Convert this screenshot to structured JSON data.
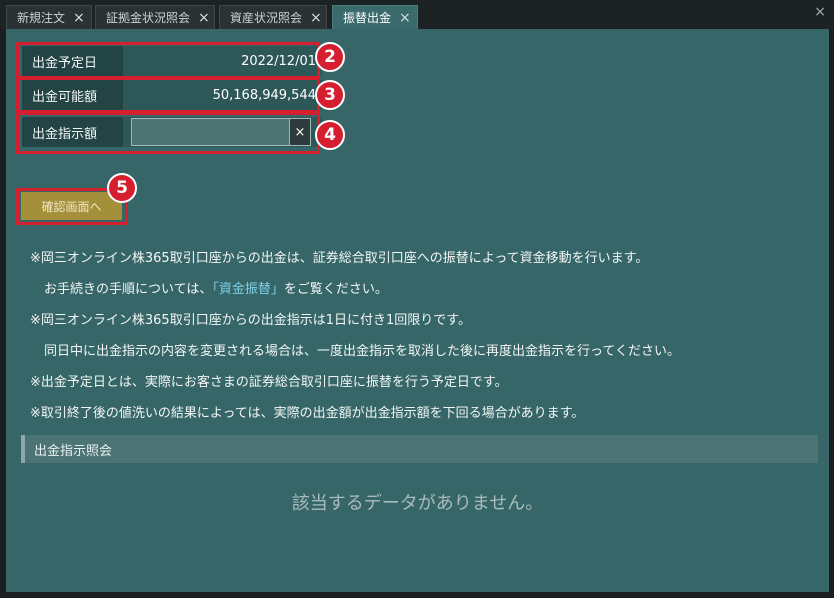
{
  "tabs": [
    {
      "label": "新規注文",
      "active": false
    },
    {
      "label": "証拠金状況照会",
      "active": false
    },
    {
      "label": "資産状況照会",
      "active": false
    },
    {
      "label": "振替出金",
      "active": true
    }
  ],
  "tab_close_glyph": "×",
  "window_close_glyph": "×",
  "form": {
    "scheduled_date": {
      "label": "出金予定日",
      "value": "2022/12/01"
    },
    "available_amount": {
      "label": "出金可能額",
      "value": "50,168,949,544"
    },
    "instruction_amount": {
      "label": "出金指示額",
      "value": "",
      "placeholder": ""
    },
    "clear_glyph": "×"
  },
  "confirm_button_label": "確認画面へ",
  "badges": [
    "2",
    "3",
    "4",
    "5"
  ],
  "notes": {
    "line1": "※岡三オンライン株365取引口座からの出金は、証券総合取引口座への振替によって資金移動を行います。",
    "line2_pre": "お手続きの手順については、",
    "line2_link": "「資金振替」",
    "line2_post": "をご覧ください。",
    "line3": "※岡三オンライン株365取引口座からの出金指示は1日に付き1回限りです。",
    "line4": "同日中に出金指示の内容を変更される場合は、一度出金指示を取消した後に再度出金指示を行ってください。",
    "line5": "※出金予定日とは、実際にお客さまの証券総合取引口座に振替を行う予定日です。",
    "line6": "※取引終了後の値洗いの結果によっては、実際の出金額が出金指示額を下回る場合があります。"
  },
  "history": {
    "title": "出金指示照会",
    "empty_message": "該当するデータがありません。"
  },
  "colors": {
    "panel_bg": "#366667",
    "highlight_red": "#d51f2f",
    "confirm_button": "#a48f3b",
    "link": "#7fd0e8"
  }
}
